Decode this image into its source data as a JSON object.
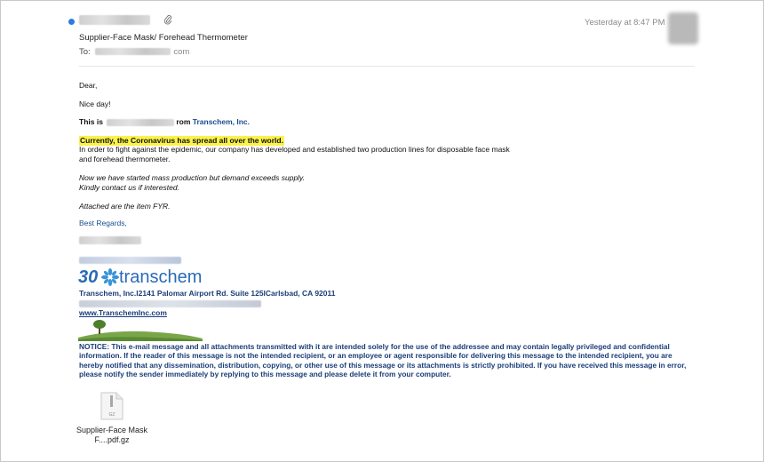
{
  "header": {
    "timestamp": "Yesterday at 8:47 PM",
    "subject": "Supplier-Face Mask/ Forehead Thermometer",
    "to_label": "To:",
    "to_domain": "com"
  },
  "body": {
    "greeting": "Dear,",
    "niceday": "Nice day!",
    "this_is_prefix": "This is",
    "this_is_suffix": "rom",
    "company": "Transchem, Inc.",
    "highlight": "Currently, the Coronavirus has spread all over the world.",
    "para1": "In order to fight against the epidemic, our company has developed  and established two production lines for disposable face mask and  forehead thermometer.",
    "italic1": "Now we have started mass production but demand exceeds supply.",
    "italic2": "Kindly contact us if interested.",
    "italic3": "Attached are the item FYR.",
    "regards": "Best Regards,"
  },
  "signature": {
    "logo_number": "30",
    "logo_word": "transchem",
    "address": "Transchem, Inc.l2141 Palomar Airport Rd. Suite 125lCarlsbad, CA 92011",
    "website": "www.TranschemInc.com",
    "notice": "NOTICE: This e-mail message and all attachments transmitted with it are intended solely for the use of the addressee and may contain legally privileged and confidential information. If the reader of this message is not the intended recipient, or an employee or agent responsible for delivering this message to the intended recipient, you are hereby notified that any dissemination, distribution, copying, or other use of this message or its attachments is strictly prohibited. If you have received this message in error, please notify the sender immediately by replying to this message and please delete it from your computer."
  },
  "attachment": {
    "ext": "GZ",
    "name": "Supplier-Face Mask F....pdf.gz"
  },
  "colors": {
    "unread": "#2a7de1",
    "link_blue": "#1a4d92",
    "highlight": "#fbf24b"
  }
}
